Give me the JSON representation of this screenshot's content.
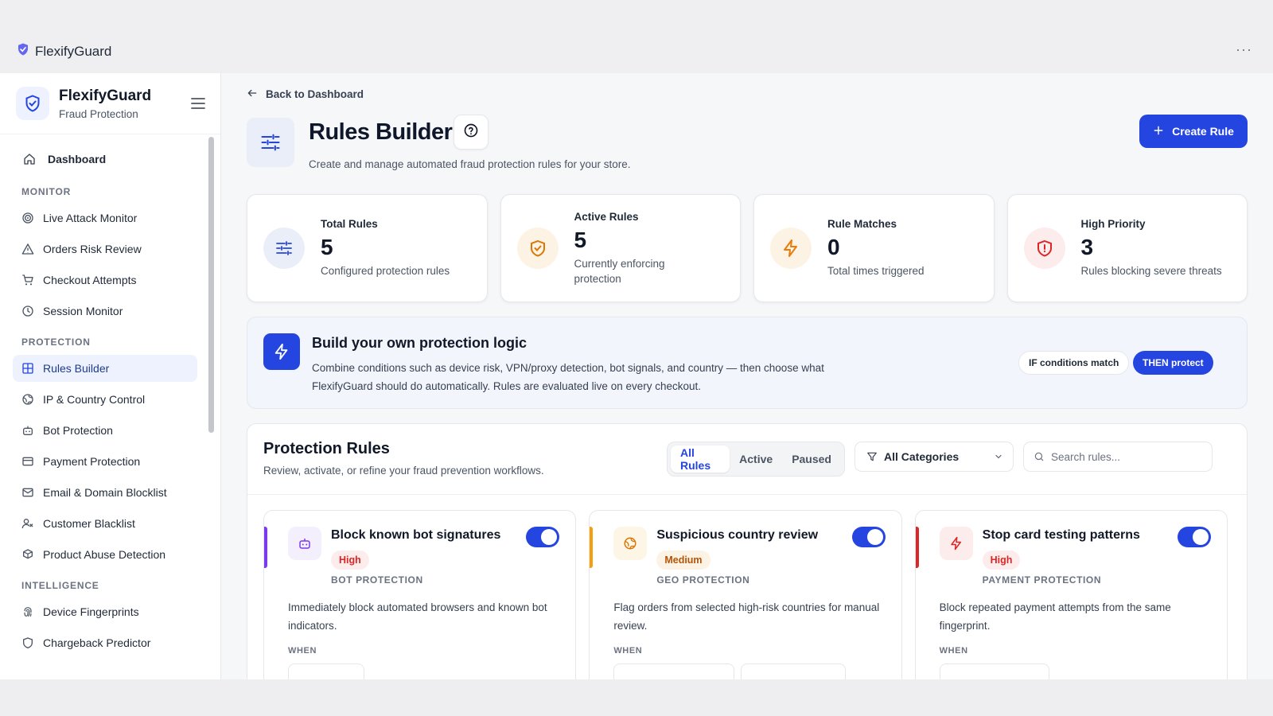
{
  "chrome": {
    "app_name": "FlexifyGuard",
    "more": "···"
  },
  "sidebar": {
    "brand_title": "FlexifyGuard",
    "brand_subtitle": "Fraud Protection",
    "dashboard": "Dashboard",
    "sections": {
      "monitor": "MONITOR",
      "protection": "PROTECTION",
      "intelligence": "INTELLIGENCE"
    },
    "monitor_items": [
      "Live Attack Monitor",
      "Orders Risk Review",
      "Checkout Attempts",
      "Session Monitor"
    ],
    "protection_items": [
      "Rules Builder",
      "IP & Country Control",
      "Bot Protection",
      "Payment Protection",
      "Email & Domain Blocklist",
      "Customer Blacklist",
      "Product Abuse Detection"
    ],
    "intelligence_items": [
      "Device Fingerprints",
      "Chargeback Predictor"
    ]
  },
  "header": {
    "back_label": "Back to Dashboard",
    "title": "Rules Builder",
    "subtitle": "Create and manage automated fraud protection rules for your store.",
    "create_label": "Create Rule"
  },
  "stats": [
    {
      "label": "Total Rules",
      "value": "5",
      "desc": "Configured protection rules"
    },
    {
      "label": "Active Rules",
      "value": "5",
      "desc": "Currently enforcing protection"
    },
    {
      "label": "Rule Matches",
      "value": "0",
      "desc": "Total times triggered"
    },
    {
      "label": "High Priority",
      "value": "3",
      "desc": "Rules blocking severe threats"
    }
  ],
  "logic": {
    "title": "Build your own protection logic",
    "desc": "Combine conditions such as device risk, VPN/proxy detection, bot signals, and country — then choose what FlexifyGuard should do automatically. Rules are evaluated live on every checkout.",
    "if_label": "IF conditions match",
    "then_label": "THEN protect"
  },
  "rules": {
    "title": "Protection Rules",
    "subtitle": "Review, activate, or refine your fraud prevention workflows.",
    "filters": [
      "All Rules",
      "Active",
      "Paused"
    ],
    "category_value": "All Categories",
    "search_placeholder": "Search rules...",
    "cards": [
      {
        "title": "Block known bot signatures",
        "priority": "High",
        "category": "BOT PROTECTION",
        "desc": "Immediately block automated browsers and known bot indicators.",
        "when": "WHEN",
        "enabled": true
      },
      {
        "title": "Suspicious country review",
        "priority": "Medium",
        "category": "GEO PROTECTION",
        "desc": "Flag orders from selected high-risk countries for manual review.",
        "when": "WHEN",
        "enabled": true
      },
      {
        "title": "Stop card testing patterns",
        "priority": "High",
        "category": "PAYMENT PROTECTION",
        "desc": "Block repeated payment attempts from the same fingerprint.",
        "when": "WHEN",
        "enabled": true
      }
    ]
  },
  "colors": {
    "primary": "#2545e0",
    "high": "#dc2626",
    "medium": "#d97706",
    "purple": "#7c3aed"
  }
}
